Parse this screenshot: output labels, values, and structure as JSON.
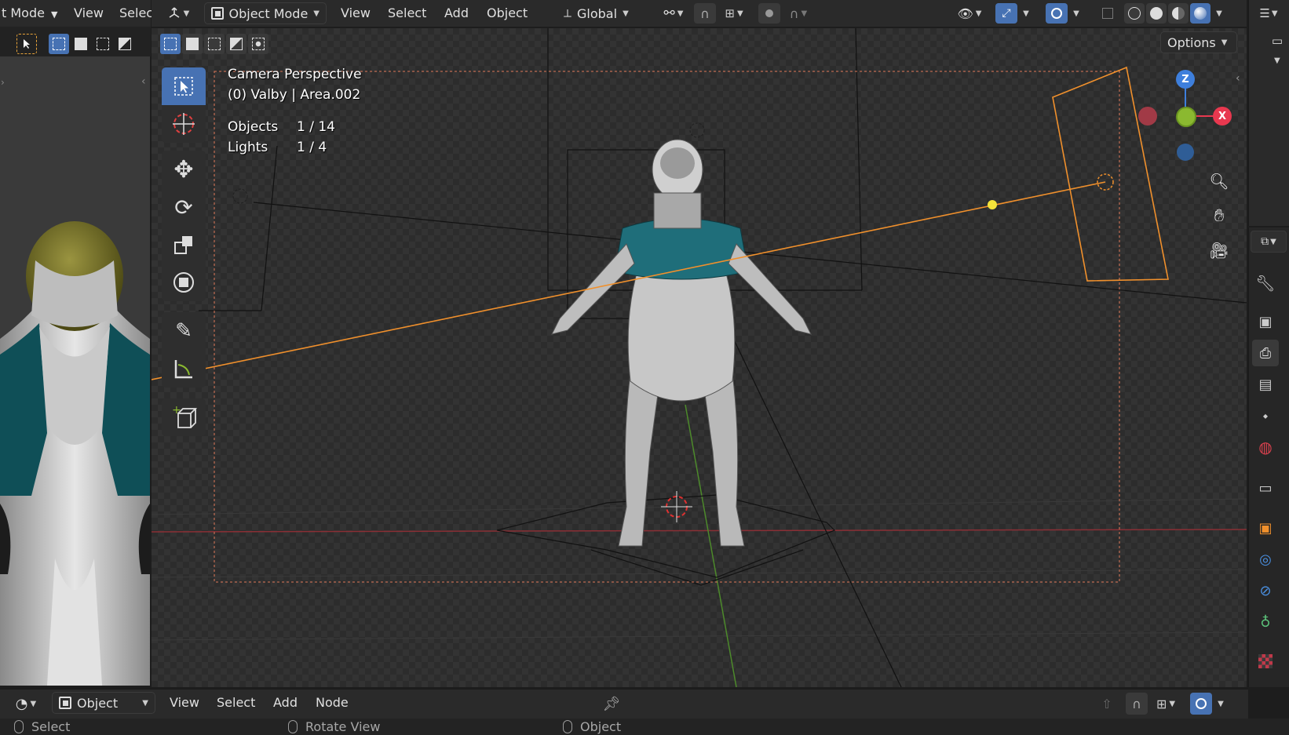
{
  "left_editor": {
    "mode_label": "t Mode",
    "menu": [
      "View",
      "Selec"
    ]
  },
  "main_header": {
    "mode_label": "Object Mode",
    "menu": [
      "View",
      "Select",
      "Add",
      "Object"
    ],
    "transform_orientation": "Global"
  },
  "viewport": {
    "options_label": "Options",
    "camera_view_label": "Camera Perspective",
    "collection_label": "(0) Valby | Area.002",
    "stats": [
      {
        "label": "Objects",
        "value": "1 / 14"
      },
      {
        "label": "Lights",
        "value": "1 / 4"
      }
    ],
    "gizmo_axes": {
      "z": "Z",
      "x": "X"
    }
  },
  "node_header": {
    "type_label": "Object",
    "menu": [
      "View",
      "Select",
      "Add",
      "Node"
    ]
  },
  "status_bar": {
    "items": [
      "Select",
      "Rotate View",
      "Object"
    ]
  },
  "colors": {
    "accent": "#4772b3",
    "camera": "#f0902c",
    "axis_x": "#e8384f",
    "axis_y": "#8bb930",
    "axis_z": "#3e7fdc",
    "light": "#f4e23a"
  }
}
